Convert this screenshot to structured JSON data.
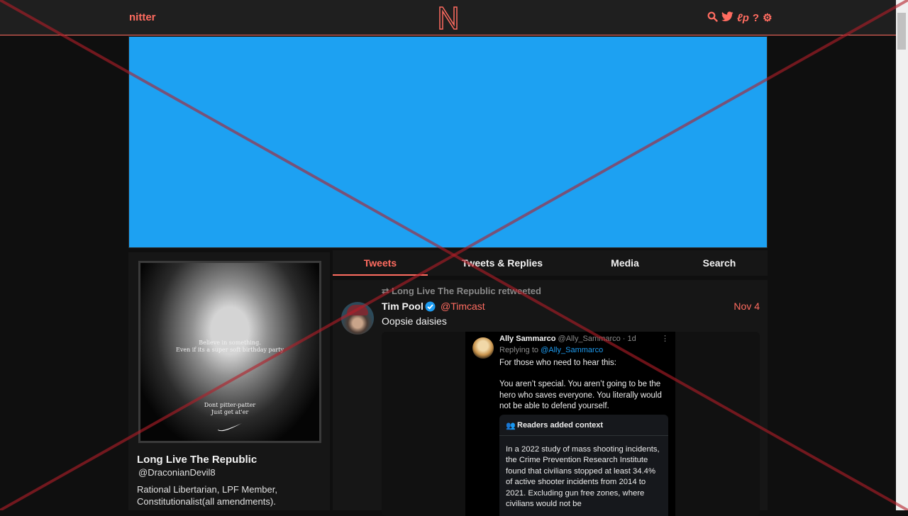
{
  "navbar": {
    "brand": "nitter",
    "icons": [
      "search-icon",
      "twitter-bird-icon",
      "lp-icon",
      "help-icon",
      "gear-icon"
    ]
  },
  "profile": {
    "fullname": "Long Live The Republic",
    "username": "@DraconianDevil8",
    "bio": "Rational Libertarian, LPF Member, Constitutionalist(all amendments).",
    "avatar_text": {
      "line1": "Believe in something.",
      "line2": "Even if its a super soft birthday party",
      "line3": "Dont pitter-patter",
      "line4": "Just get at'er"
    }
  },
  "tabs": [
    {
      "label": "Tweets",
      "active": true
    },
    {
      "label": "Tweets & Replies",
      "active": false
    },
    {
      "label": "Media",
      "active": false
    },
    {
      "label": "Search",
      "active": false
    }
  ],
  "tweet": {
    "retweet_header": "Long Live The Republic retweeted",
    "author_name": "Tim Pool",
    "author_handle": "@Timcast",
    "date": "Nov 4",
    "text": "Oopsie daisies",
    "embedded_screenshot": {
      "name": "Ally Sammarco",
      "meta": "@Ally_Sammarco · 1d",
      "menu": "⋮",
      "replying_prefix": "Replying to",
      "replying_handle": "@Ally_Sammarco",
      "line1": "For those who need to hear this:",
      "line2": "You aren’t special. You aren’t going to be the hero who saves everyone. You literally would not be able to defend yourself.",
      "notes_header": "Readers added context",
      "notes_text": "In a 2022 study of mass shooting incidents, the Crime Prevention Research Institute found that civilians stopped at least 34.4% of active shooter incidents from 2014 to 2021. Excluding gun free zones, where civilians would not be"
    }
  },
  "colors": {
    "accent": "#ff6c60",
    "banner": "#1da1f2",
    "background": "#0f0f0f",
    "panel": "#161616",
    "navbar": "#1f1f1f",
    "overlay": "#b41e28"
  }
}
